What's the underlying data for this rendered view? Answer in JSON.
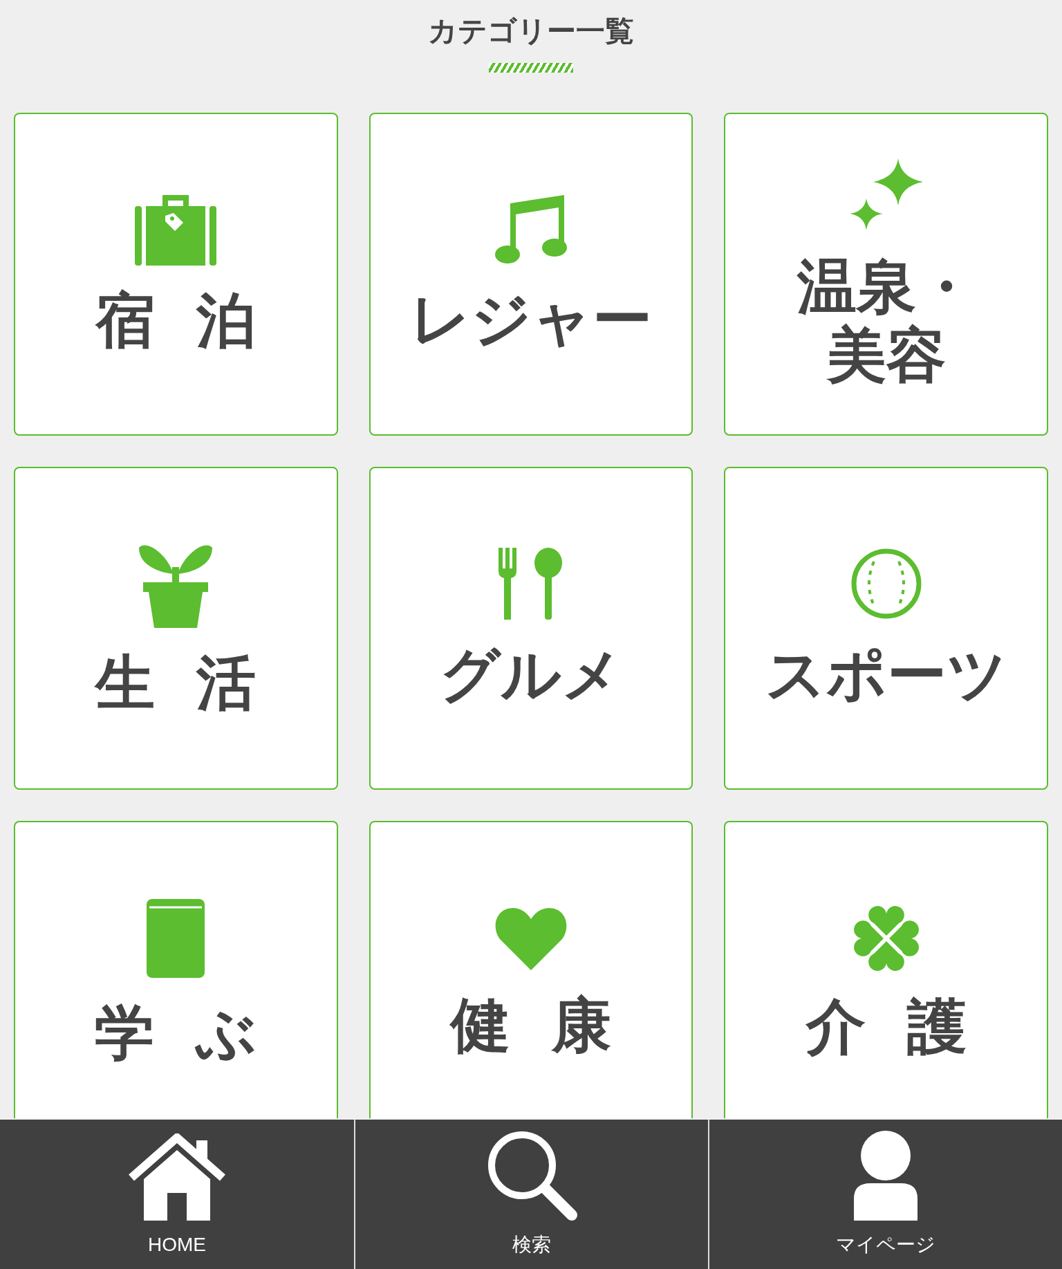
{
  "title": "カテゴリー一覧",
  "categories": [
    {
      "label": "宿泊"
    },
    {
      "label": "レジャー"
    },
    {
      "label": "温泉・美容"
    },
    {
      "label": "生活"
    },
    {
      "label": "グルメ"
    },
    {
      "label": "スポーツ"
    },
    {
      "label": "学ぶ"
    },
    {
      "label": "健康"
    },
    {
      "label": "介護"
    }
  ],
  "nav": [
    {
      "label": "HOME"
    },
    {
      "label": "検索"
    },
    {
      "label": "マイページ"
    }
  ]
}
